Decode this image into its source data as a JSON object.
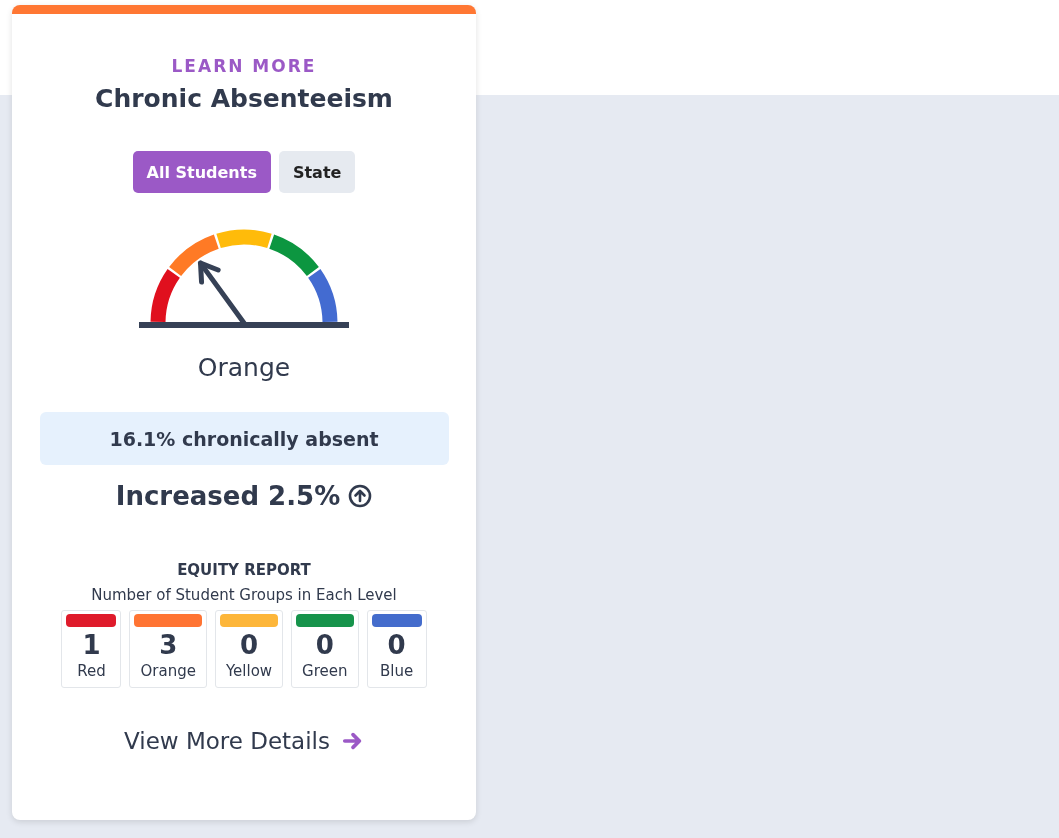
{
  "card": {
    "eyebrow": "LEARN MORE",
    "title": "Chronic Absenteeism",
    "tabs": [
      {
        "label": "All Students",
        "selected": true
      },
      {
        "label": "State",
        "selected": false
      }
    ],
    "gauge": {
      "segments": [
        {
          "color": "#e0101e",
          "selected": false
        },
        {
          "color": "#ff7a25",
          "selected": true
        },
        {
          "color": "#ffbb0a",
          "selected": false
        },
        {
          "color": "#0c9640",
          "selected": false
        },
        {
          "color": "#436bd1",
          "selected": false
        }
      ],
      "label": "Orange"
    },
    "rate": "16.1% chronically absent",
    "change": {
      "text": "Increased 2.5%"
    },
    "equity": {
      "title": "EQUITY REPORT",
      "subtitle": "Number of Student Groups in Each Level",
      "levels": [
        {
          "color": "#df1b2b",
          "count": "1",
          "label": "Red"
        },
        {
          "color": "#ff7433",
          "count": "3",
          "label": "Orange"
        },
        {
          "color": "#fdb63a",
          "count": "0",
          "label": "Yellow"
        },
        {
          "color": "#16934b",
          "count": "0",
          "label": "Green"
        },
        {
          "color": "#446ccc",
          "count": "0",
          "label": "Blue"
        }
      ]
    },
    "link": "View More Details"
  }
}
